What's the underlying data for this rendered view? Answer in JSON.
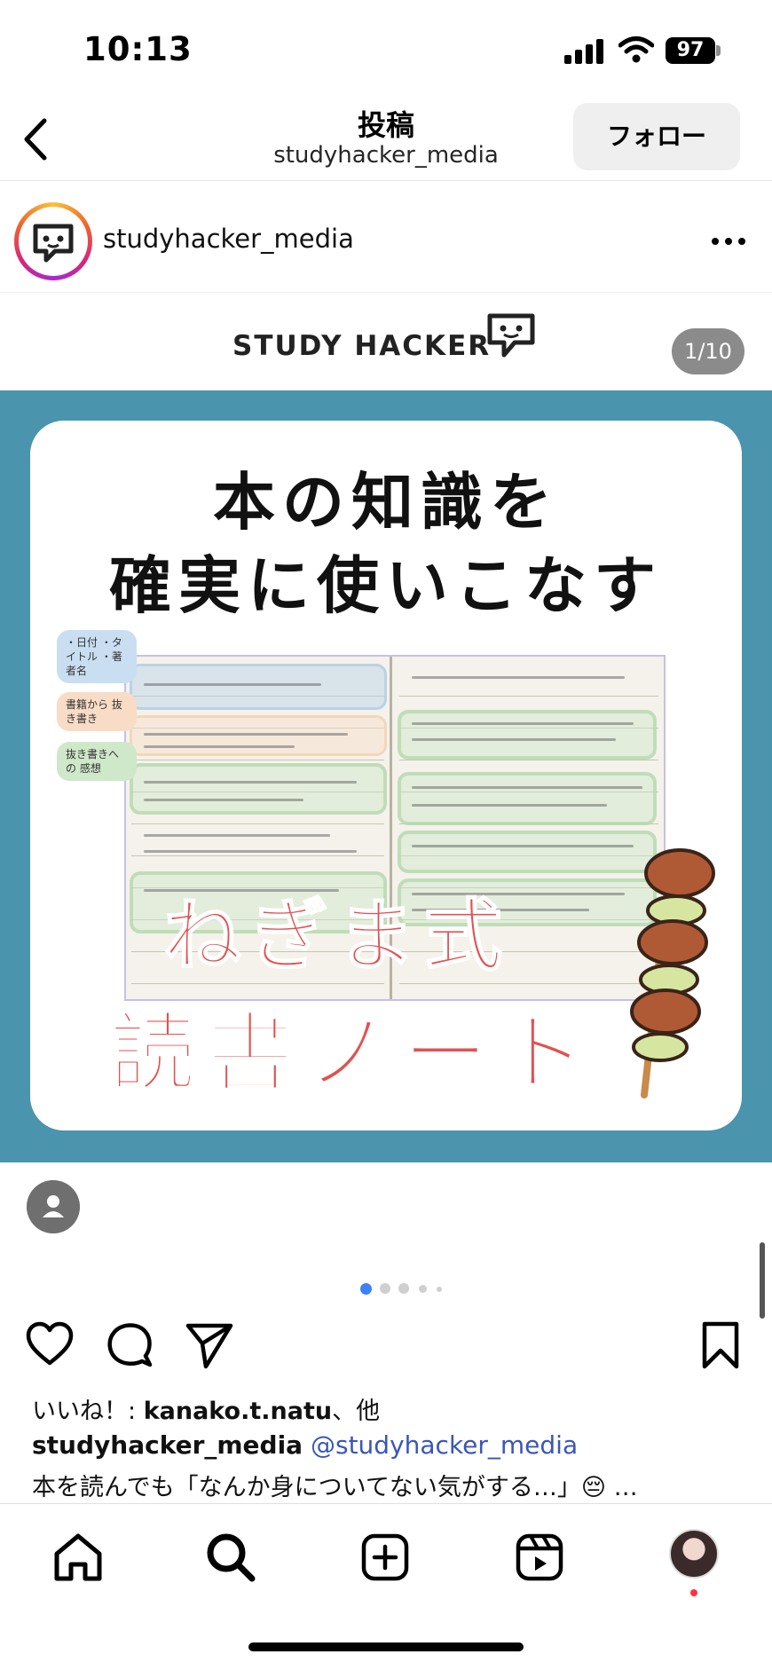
{
  "status_bar": {
    "time": "10:13",
    "battery": "97"
  },
  "nav": {
    "title": "投稿",
    "subtitle": "studyhacker_media",
    "follow_label": "フォロー"
  },
  "post": {
    "username": "studyhacker_media"
  },
  "banner": {
    "brand": "STUDY HACKER",
    "page_counter": "1/10"
  },
  "card": {
    "title_line1": "本の知識を",
    "title_line2": "確実に使いこなす",
    "labels": [
      "・日付 ・タイトル ・著者名",
      "書籍から 抜き書き",
      "抜き書きへの 感想"
    ],
    "headline_line1": "ねぎま式",
    "headline_line2": "読書ノート"
  },
  "carousel": {
    "dot_count": 5,
    "active_dot": 0
  },
  "engagement": {
    "likes_prefix": "いいね！: ",
    "likes_user": "kanako.t.natu",
    "likes_suffix": "、他",
    "caption_user": "studyhacker_media",
    "caption_mention": "@studyhacker_media",
    "caption_text": "本を読んでも「なんか身についてない気がする…」😔 …"
  },
  "colors": {
    "carousel_bg": "#4a94ad",
    "headline": "#e05252",
    "mention": "#3b56b8"
  },
  "icons": [
    "back-icon",
    "more-icon",
    "heart-icon",
    "comment-icon",
    "share-icon",
    "bookmark-icon",
    "home-icon",
    "search-icon",
    "create-icon",
    "reels-icon"
  ]
}
